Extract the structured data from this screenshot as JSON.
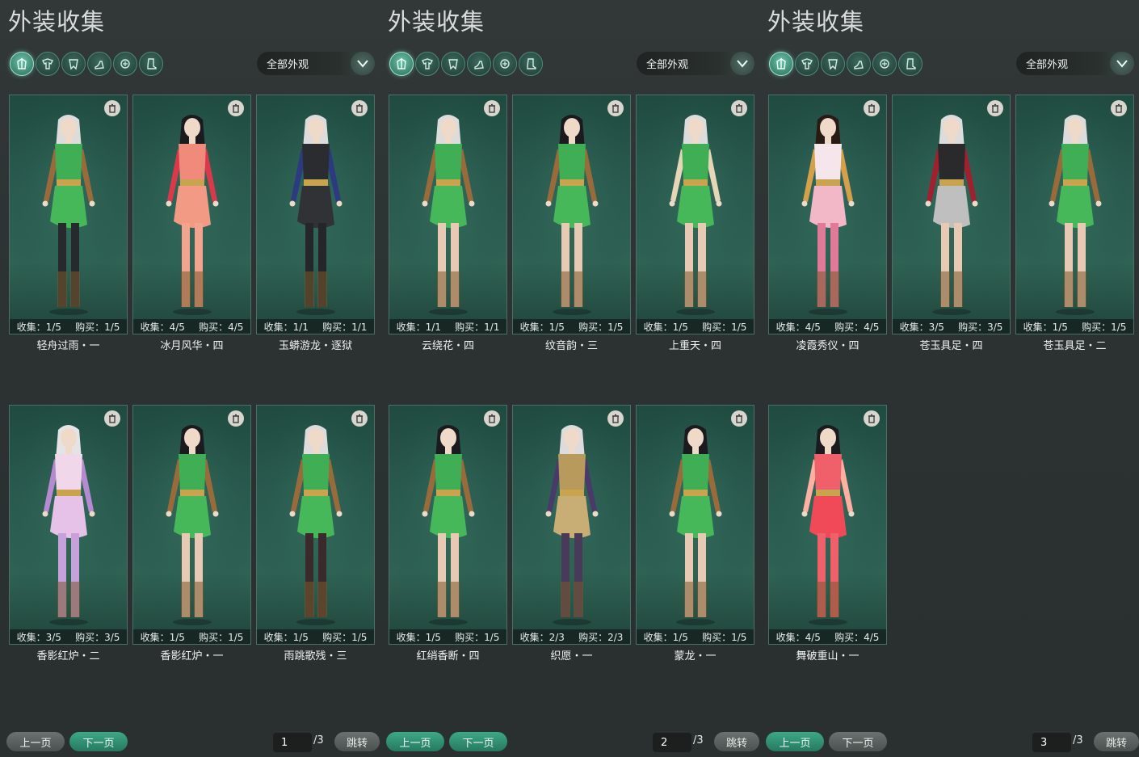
{
  "panels": [
    {
      "title": "外装收集",
      "filter_selected": "全部外观",
      "cards": [
        {
          "name": "轻舟过雨・一",
          "collect": "收集：1/5",
          "buy": "购买：1/5",
          "hair": "#dcdcdc",
          "outfit": "#3fae55",
          "skirt": "#46b85a",
          "legs": "#262a2c",
          "accent": "#9a6b3a"
        },
        {
          "name": "冰月风华・四",
          "collect": "收集：4/5",
          "buy": "购买：4/5",
          "hair": "#1b1b1f",
          "outfit": "#f08a7a",
          "skirt": "#f39a84",
          "legs": "#f4a48e",
          "accent": "#d9394a"
        },
        {
          "name": "玉蟒游龙・逐狱",
          "collect": "收集：1/1",
          "buy": "购买：1/1",
          "hair": "#dcdcdc",
          "outfit": "#2a2c30",
          "skirt": "#303236",
          "legs": "#242629",
          "accent": "#2c3a80"
        },
        {
          "name": "香影红炉・二",
          "collect": "收集：3/5",
          "buy": "购买：3/5",
          "hair": "#e6e3e6",
          "outfit": "#f1d7ea",
          "skirt": "#e6c2e8",
          "legs": "#c6a1da",
          "accent": "#b68ad0"
        },
        {
          "name": "香影红炉・一",
          "collect": "收集：1/5",
          "buy": "购买：1/5",
          "hair": "#1b1b1f",
          "outfit": "#3fae55",
          "skirt": "#46b85a",
          "legs": "#e8c9b3",
          "accent": "#9a6b3a"
        },
        {
          "name": "雨跳歌残・三",
          "collect": "收集：1/5",
          "buy": "购买：1/5",
          "hair": "#dcdcdc",
          "outfit": "#3fae55",
          "skirt": "#46b85a",
          "legs": "#3a2a2c",
          "accent": "#9a6b3a"
        }
      ],
      "pager": {
        "prev": "上一页",
        "next": "下一页",
        "page": "1",
        "total": "/3",
        "jump": "跳转"
      }
    },
    {
      "title": "外装收集",
      "filter_selected": "全部外观",
      "cards": [
        {
          "name": "云绕花・四",
          "collect": "收集：1/1",
          "buy": "购买：1/1",
          "hair": "#dcdcdc",
          "outfit": "#3fae55",
          "skirt": "#46b85a",
          "legs": "#e8c9b3",
          "accent": "#9a6b3a"
        },
        {
          "name": "纹音韵・三",
          "collect": "收集：1/5",
          "buy": "购买：1/5",
          "hair": "#1b1b1f",
          "outfit": "#3fae55",
          "skirt": "#46b85a",
          "legs": "#e8c9b3",
          "accent": "#9a6b3a"
        },
        {
          "name": "上重天・四",
          "collect": "收集：1/5",
          "buy": "购买：1/5",
          "hair": "#dcdcdc",
          "outfit": "#3fae55",
          "skirt": "#46b85a",
          "legs": "#e8c9b3",
          "accent": "#e6d6b8"
        },
        {
          "name": "红绡香断・四",
          "collect": "收集：1/5",
          "buy": "购买：1/5",
          "hair": "#1b1b1f",
          "outfit": "#3fae55",
          "skirt": "#46b85a",
          "legs": "#e8c9b3",
          "accent": "#9a6b3a"
        },
        {
          "name": "织愿・一",
          "collect": "收集：2/3",
          "buy": "购买：2/3",
          "hair": "#dcdcdc",
          "outfit": "#b89a5c",
          "skirt": "#c8ad74",
          "legs": "#4a3a5a",
          "accent": "#4a3a6a"
        },
        {
          "name": "蒙龙・一",
          "collect": "收集：1/5",
          "buy": "购买：1/5",
          "hair": "#1b1b1f",
          "outfit": "#3fae55",
          "skirt": "#46b85a",
          "legs": "#e8c9b3",
          "accent": "#9a6b3a"
        }
      ],
      "pager": {
        "prev": "上一页",
        "next": "下一页",
        "page": "2",
        "total": "/3",
        "jump": "跳转"
      }
    },
    {
      "title": "外装收集",
      "filter_selected": "全部外观",
      "cards": [
        {
          "name": "凌霞秀仪・四",
          "collect": "收集：4/5",
          "buy": "购买：4/5",
          "hair": "#2a1a14",
          "outfit": "#f4e6ea",
          "skirt": "#f2b8c8",
          "legs": "#e07a98",
          "accent": "#d4a04a"
        },
        {
          "name": "苍玉具足・四",
          "collect": "收集：3/5",
          "buy": "购买：3/5",
          "hair": "#dcdcdc",
          "outfit": "#2a2a2c",
          "skirt": "#bfbfbf",
          "legs": "#e8c9b3",
          "accent": "#a0202e"
        },
        {
          "name": "苍玉具足・二",
          "collect": "收集：1/5",
          "buy": "购买：1/5",
          "hair": "#dcdcdc",
          "outfit": "#3fae55",
          "skirt": "#46b85a",
          "legs": "#e8c9b3",
          "accent": "#9a6b3a"
        },
        {
          "name": "舞破重山・一",
          "collect": "收集：4/5",
          "buy": "购买：4/5",
          "hair": "#1b1b1f",
          "outfit": "#f0606a",
          "skirt": "#f04a58",
          "legs": "#f0606a",
          "accent": "#ffb0a0"
        }
      ],
      "pager": {
        "prev": "上一页",
        "next": "下一页",
        "page": "3",
        "total": "/3",
        "jump": "跳转"
      }
    }
  ],
  "icons": [
    "all-outfit-icon",
    "top-icon",
    "bottom-icon",
    "shoe-icon",
    "accessory-icon",
    "boot-icon"
  ]
}
